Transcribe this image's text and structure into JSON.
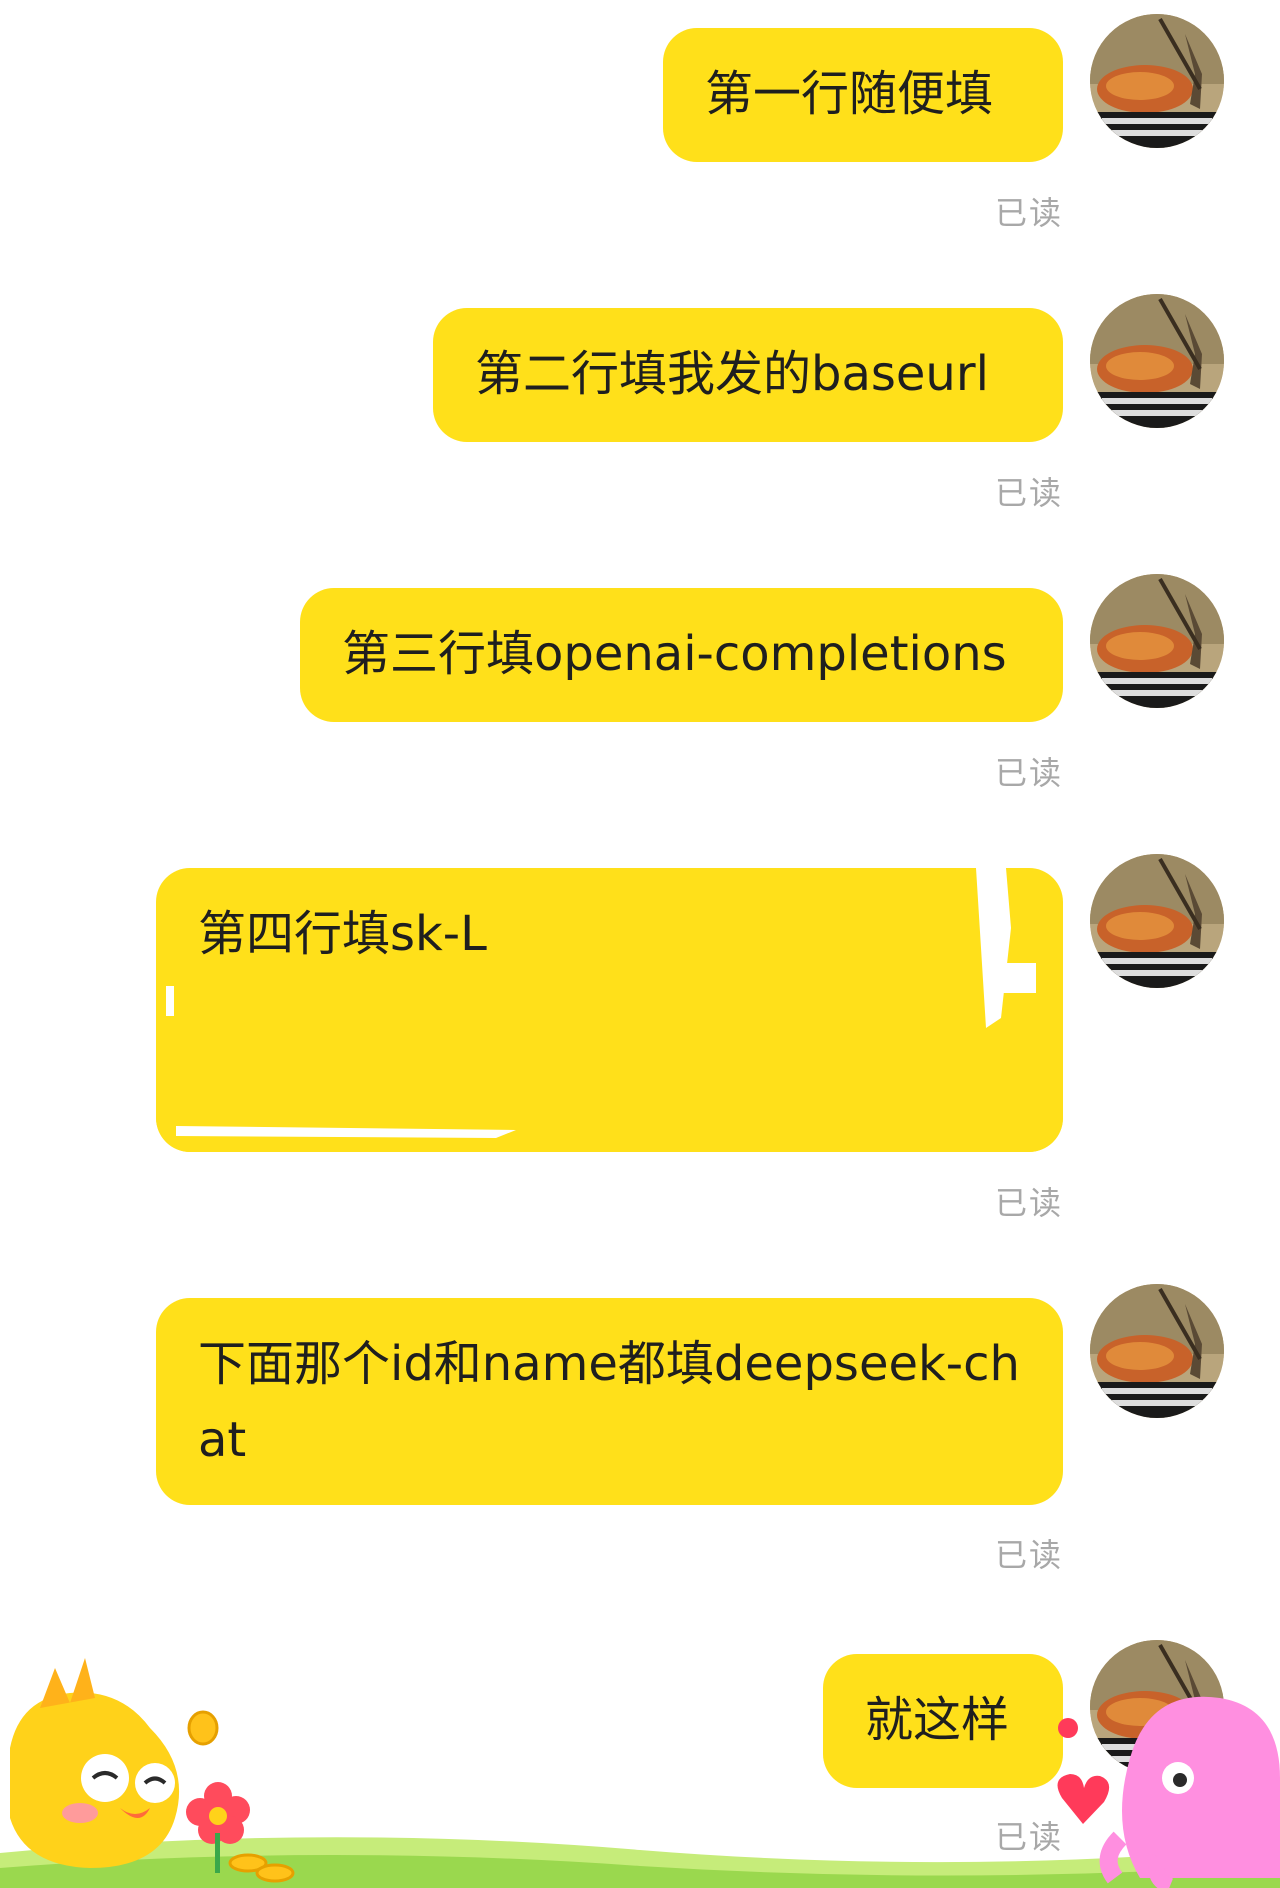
{
  "messages": [
    {
      "text": "第一行随便填",
      "status": "已读"
    },
    {
      "text": "第二行填我发的baseurl",
      "status": "已读"
    },
    {
      "text": "第三行填openai-completions",
      "status": "已读"
    },
    {
      "text": "第四行填sk-L",
      "status": "已读"
    },
    {
      "text": "下面那个id和name都填deepseek-chat",
      "status": "已读"
    },
    {
      "text": "就这样",
      "status": "已读"
    }
  ],
  "colors": {
    "bubble": "#ffe01a",
    "read_status": "#a8a8a8",
    "background": "#ffffff"
  }
}
